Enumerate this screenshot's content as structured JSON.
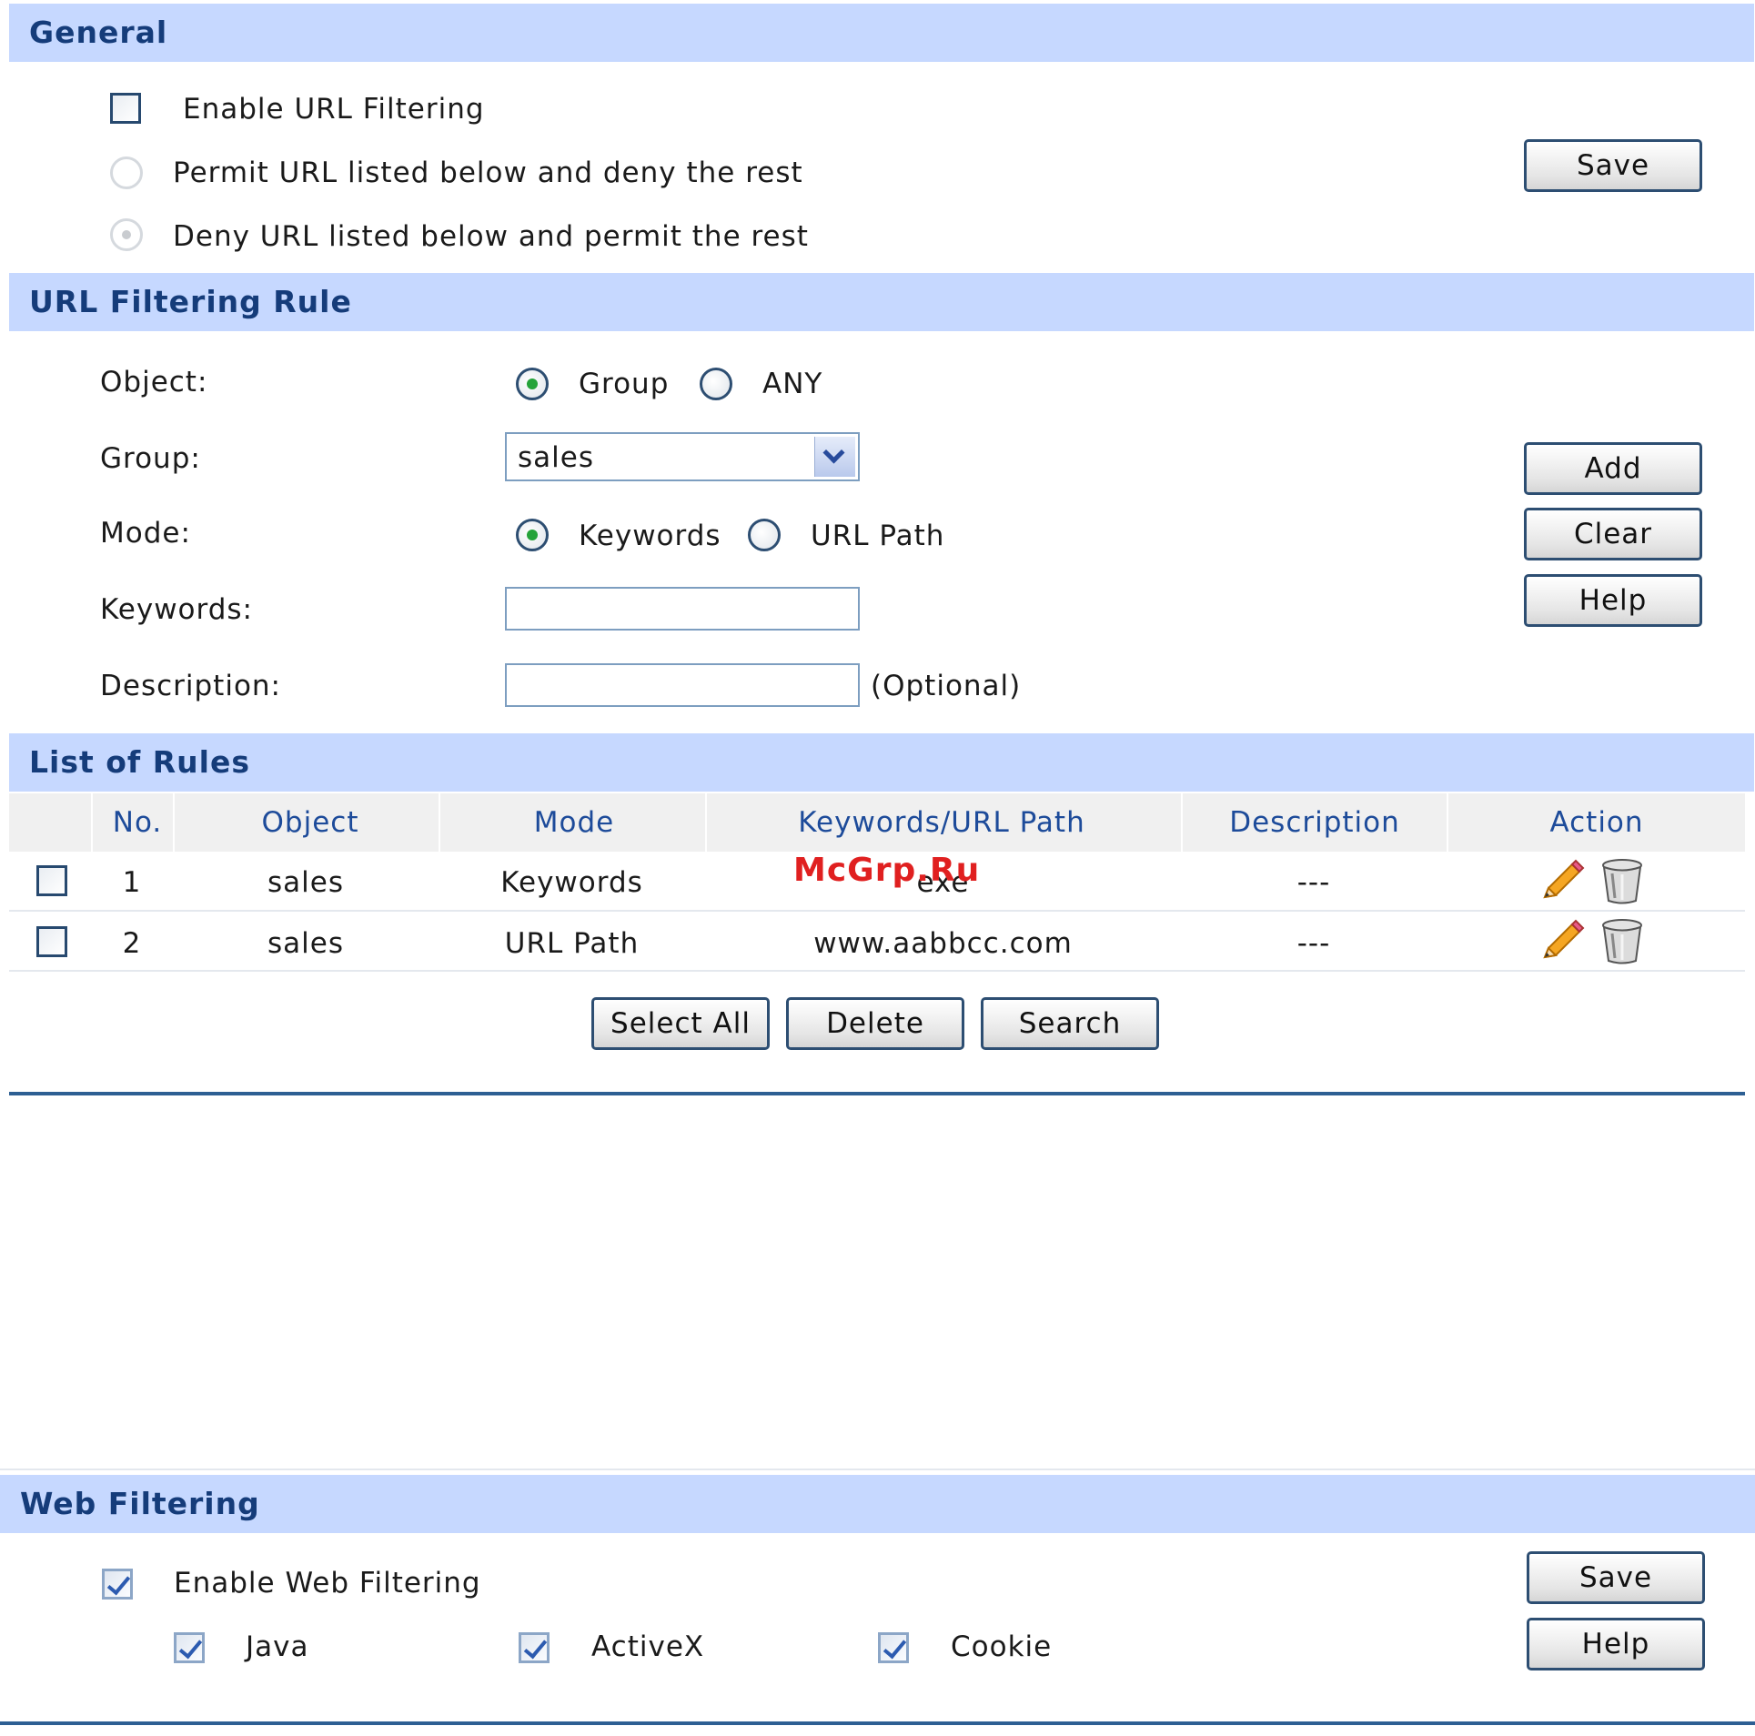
{
  "general": {
    "title": "General",
    "enable_label": "Enable URL Filtering",
    "permit_label": "Permit URL listed below and deny the rest",
    "deny_label": "Deny URL listed below and permit the rest",
    "save_label": "Save"
  },
  "rule": {
    "title": "URL Filtering Rule",
    "object_label": "Object:",
    "object_group": "Group",
    "object_any": "ANY",
    "group_label": "Group:",
    "group_value": "sales",
    "mode_label": "Mode:",
    "mode_keywords": "Keywords",
    "mode_urlpath": "URL Path",
    "keywords_label": "Keywords:",
    "keywords_value": "",
    "description_label": "Description:",
    "description_value": "",
    "optional_label": "(Optional)",
    "add_label": "Add",
    "clear_label": "Clear",
    "help_label": "Help"
  },
  "list": {
    "title": "List of Rules",
    "columns": [
      "No.",
      "Object",
      "Mode",
      "Keywords/URL Path",
      "Description",
      "Action"
    ],
    "rows": [
      {
        "no": "1",
        "object": "sales",
        "mode": "Keywords",
        "path": "exe",
        "description": "---"
      },
      {
        "no": "2",
        "object": "sales",
        "mode": "URL Path",
        "path": "www.aabbcc.com",
        "description": "---"
      }
    ],
    "select_all_label": "Select All",
    "delete_label": "Delete",
    "search_label": "Search"
  },
  "watermark": "McGrp.Ru",
  "web": {
    "title": "Web Filtering",
    "enable_label": "Enable Web Filtering",
    "java_label": "Java",
    "activex_label": "ActiveX",
    "cookie_label": "Cookie",
    "save_label": "Save",
    "help_label": "Help"
  }
}
